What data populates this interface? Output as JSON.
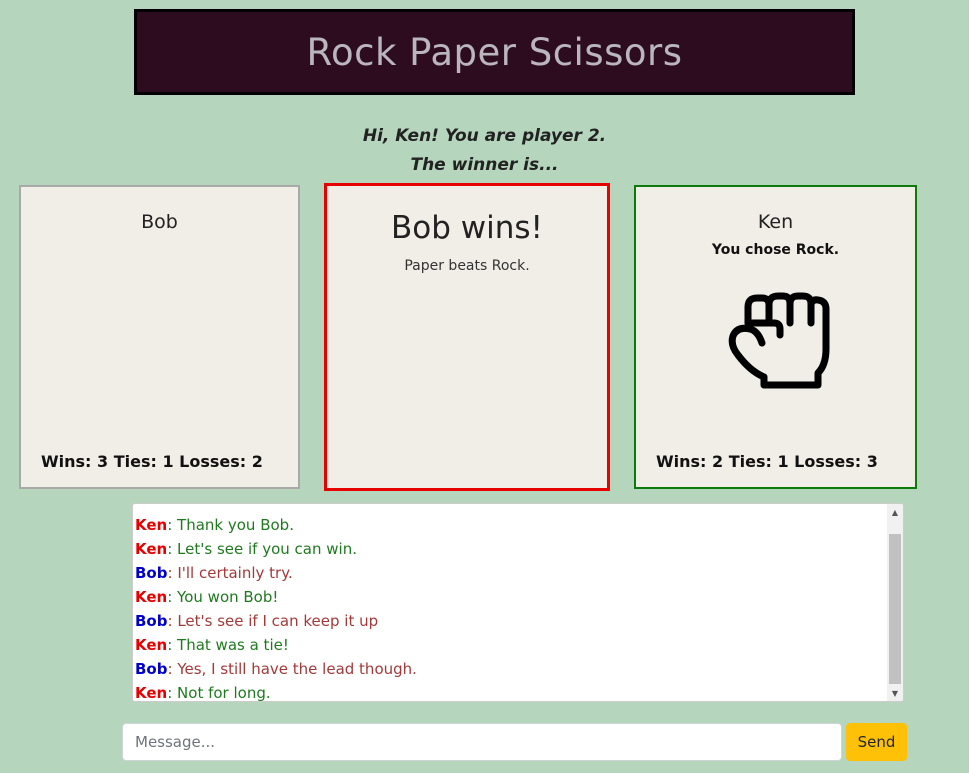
{
  "header": {
    "title": "Rock Paper Scissors"
  },
  "greeting": {
    "line1": "Hi, Ken! You are player 2.",
    "line2": "The winner is..."
  },
  "player1": {
    "name": "Bob",
    "stats": "Wins: 3 Ties: 1 Losses: 2",
    "border_color": "#a9a9a9"
  },
  "result": {
    "headline": "Bob wins!",
    "detail": "Paper beats Rock.",
    "border_color": "#e60000"
  },
  "player2": {
    "name": "Ken",
    "choice_text": "You chose Rock.",
    "choice_icon": "rock-fist-icon",
    "stats": "Wins: 2 Ties: 1 Losses: 3",
    "border_color": "#0b7a0b"
  },
  "colors": {
    "background": "#b5d6bd",
    "banner": "#2e0c20",
    "ken_name": "#e60000",
    "ken_text": "#1f7a1f",
    "bob_name": "#0000cc",
    "bob_text": "#a33a3a",
    "send_button": "#ffc107"
  },
  "chat": {
    "messages": [
      {
        "sender": "Ken",
        "sep": ": ",
        "text": "Thank you Bob."
      },
      {
        "sender": "Ken",
        "sep": ": ",
        "text": "Let's see if you can win."
      },
      {
        "sender": "Bob",
        "sep": ": ",
        "text": "I'll certainly try."
      },
      {
        "sender": "Ken",
        "sep": ": ",
        "text": "You won Bob!"
      },
      {
        "sender": "Bob",
        "sep": ": ",
        "text": "Let's see if I can keep it up"
      },
      {
        "sender": "Ken",
        "sep": ": ",
        "text": "That was a tie!"
      },
      {
        "sender": "Bob",
        "sep": ": ",
        "text": "Yes, I still have the lead though."
      },
      {
        "sender": "Ken",
        "sep": ": ",
        "text": "Not for long."
      }
    ],
    "input_placeholder": "Message...",
    "input_value": "",
    "send_label": "Send"
  }
}
